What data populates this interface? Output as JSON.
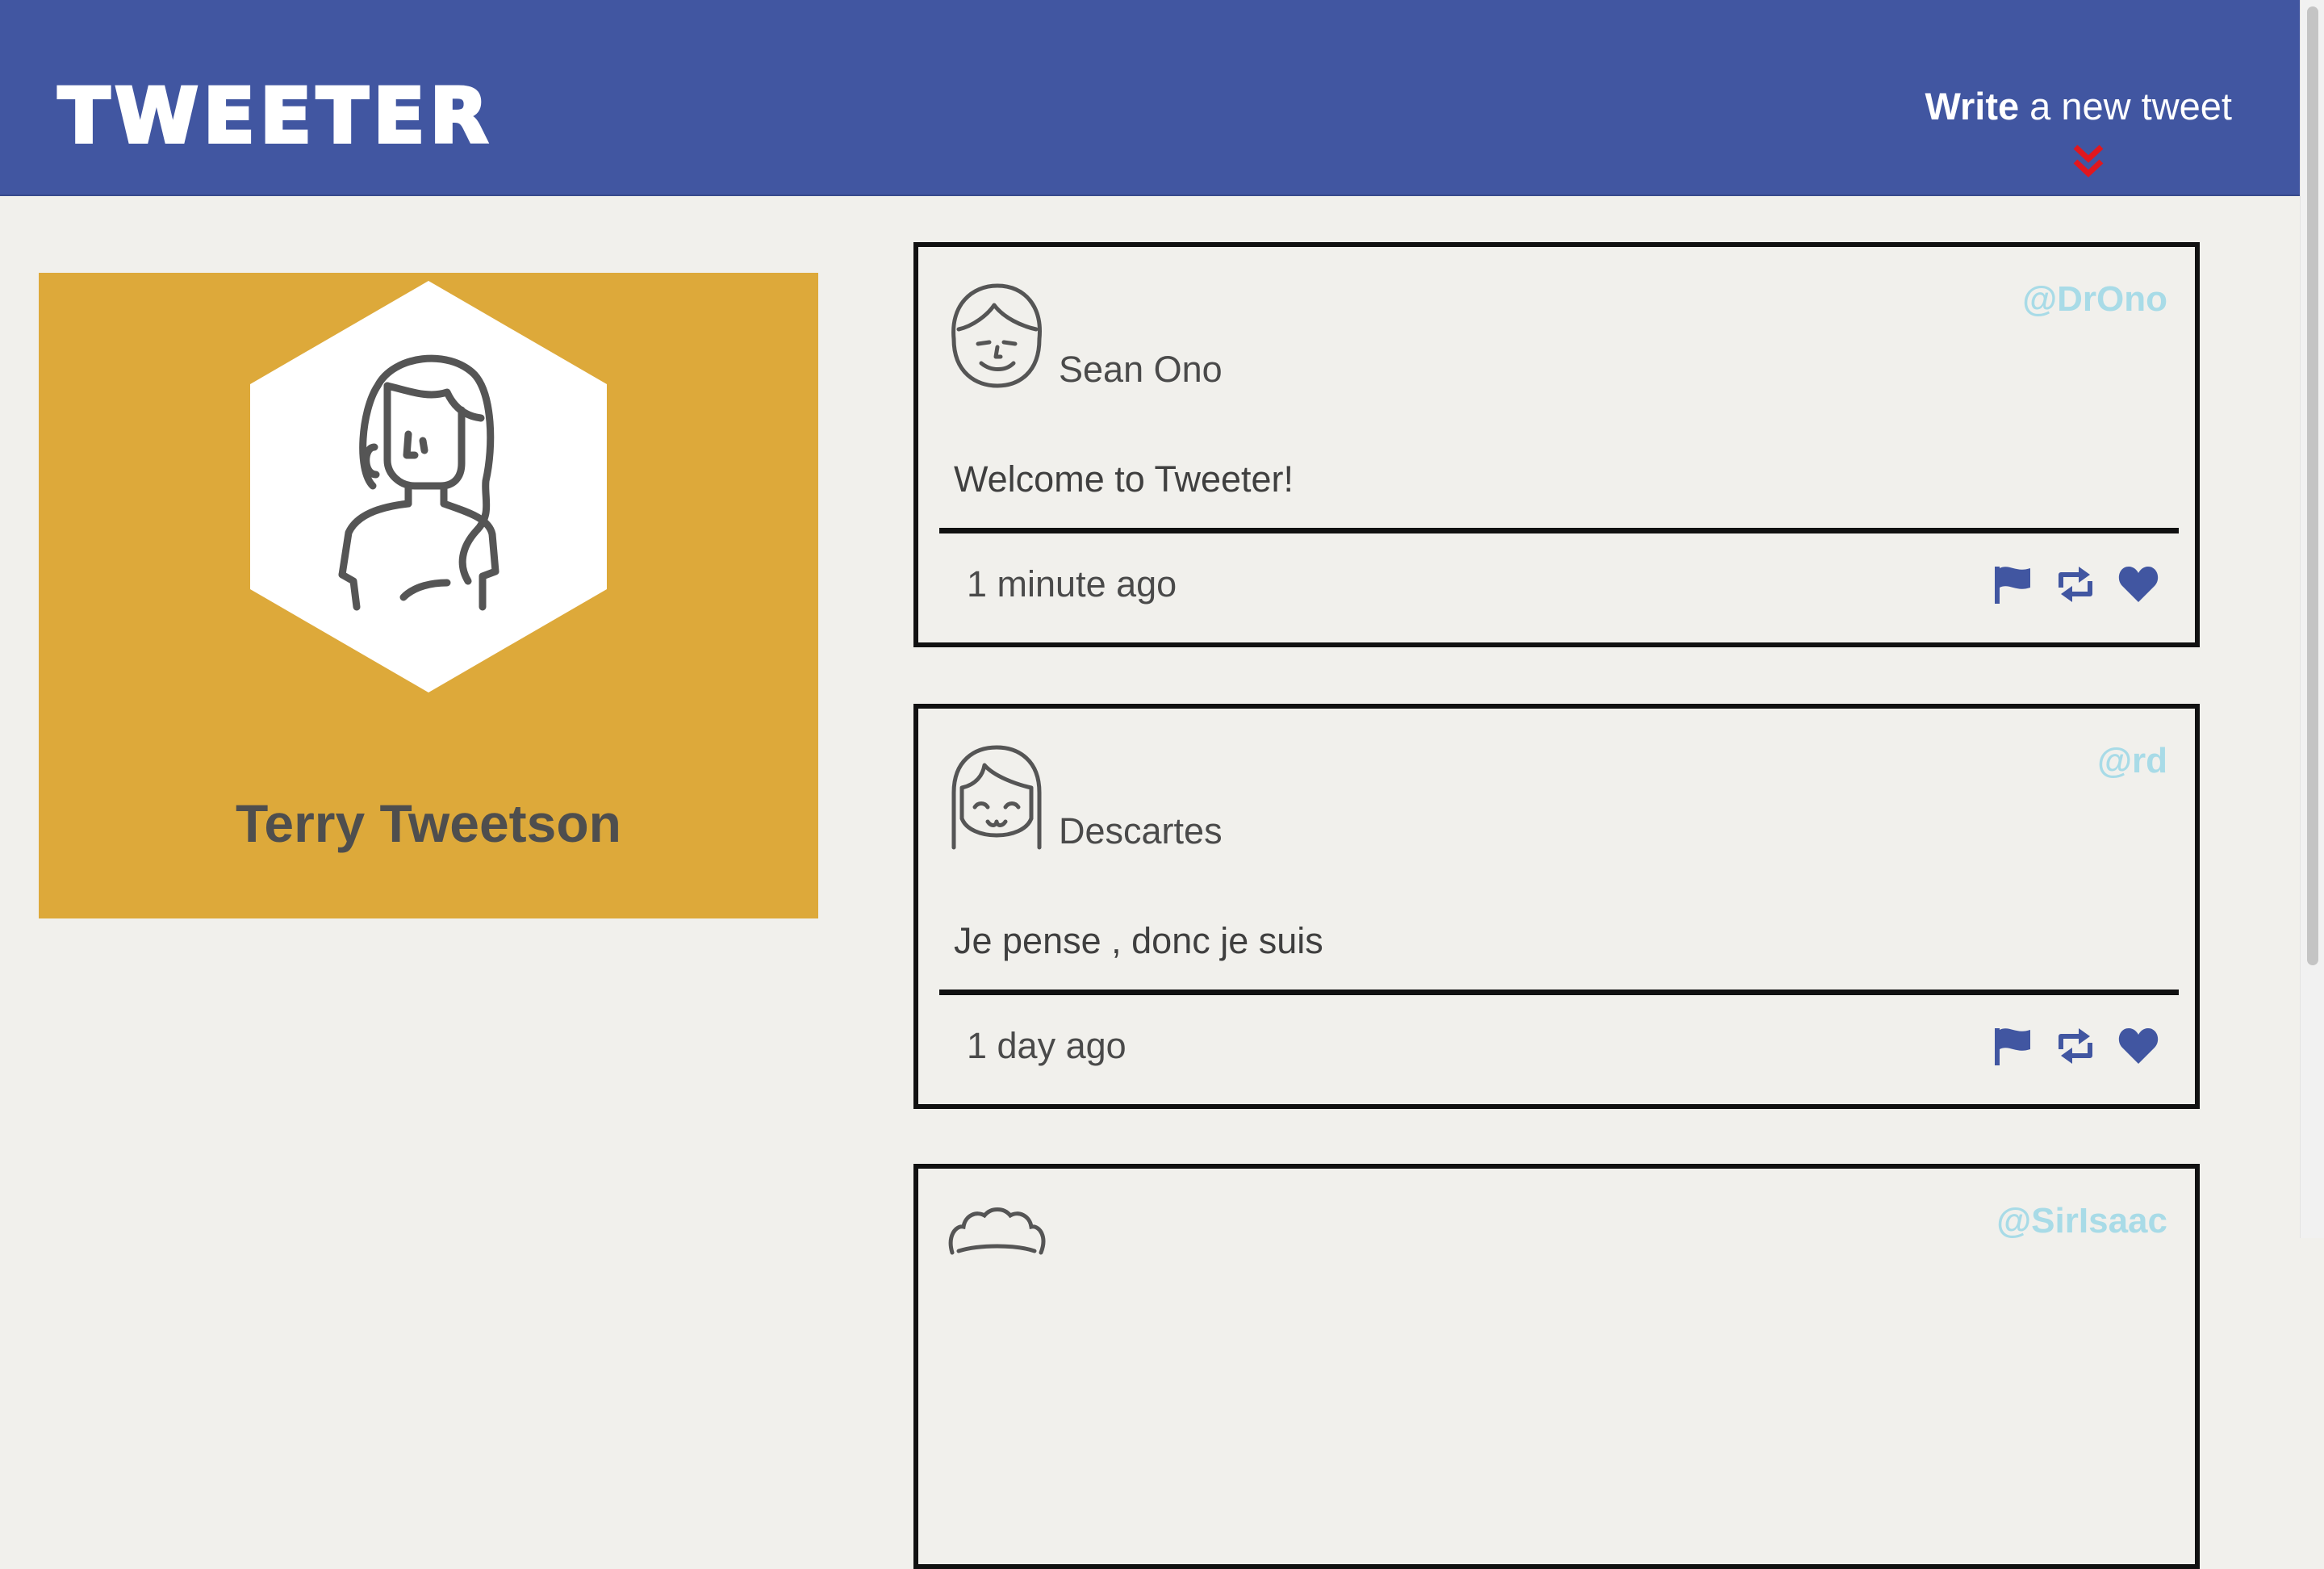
{
  "nav": {
    "brand": "TWEETER",
    "compose_bold": "Write",
    "compose_rest": " a new tweet",
    "compose_icon": "double-chevron-down-icon"
  },
  "profile": {
    "name": "Terry Tweetson",
    "avatar_icon": "woman-avatar-icon",
    "card_color": "#dda93a"
  },
  "tweets": [
    {
      "name": "Sean Ono",
      "handle": "@DrOno",
      "content": "Welcome to Tweeter!",
      "time": "1 minute ago",
      "avatar_icon": "man-avatar-icon"
    },
    {
      "name": "Descartes",
      "handle": "@rd",
      "content": "Je pense , donc je suis",
      "time": "1 day ago",
      "avatar_icon": "girl-avatar-icon"
    },
    {
      "name": "",
      "handle": "@SirIsaac",
      "content": "",
      "time": "",
      "avatar_icon": "curly-hair-avatar-icon"
    }
  ],
  "actions": [
    "flag-icon",
    "retweet-icon",
    "heart-icon"
  ],
  "colors": {
    "nav_bg": "#4156a1",
    "accent_red": "#e1171e",
    "handle": "#a8dbe7",
    "action_blue": "#4156a1",
    "page_bg": "#f1f0ec"
  }
}
